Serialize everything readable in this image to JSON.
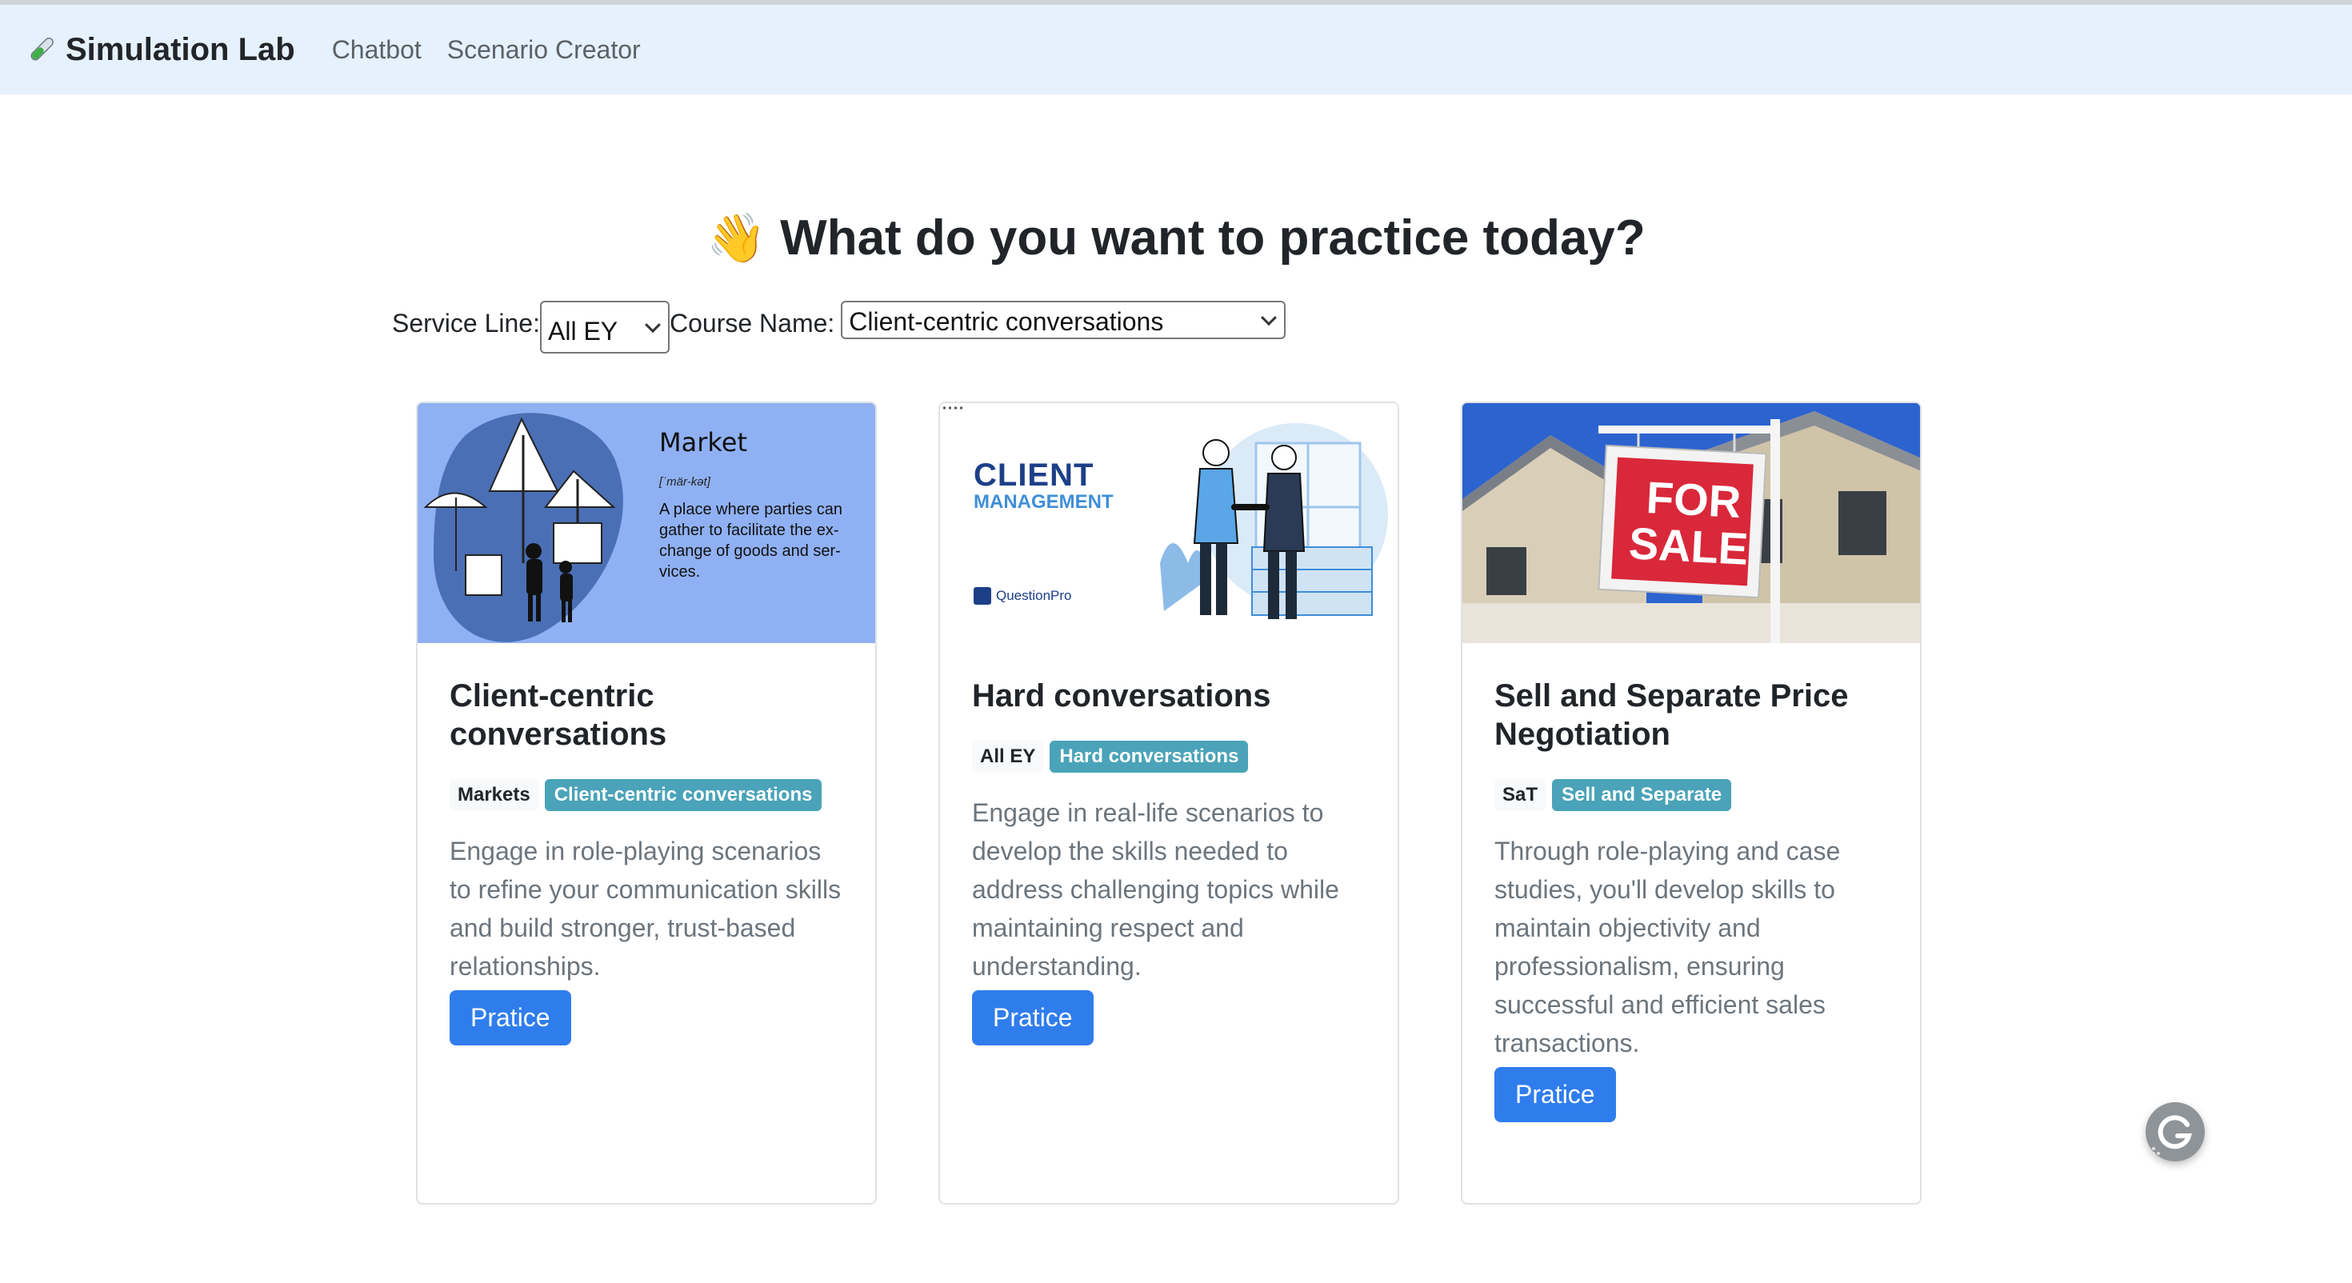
{
  "nav": {
    "brand": "Simulation Lab",
    "links": [
      "Chatbot",
      "Scenario Creator"
    ]
  },
  "page": {
    "emoji": "👋",
    "title": "What do you want to practice today?"
  },
  "filters": {
    "service_line_label": "Service Line:",
    "service_line_value": "All EY",
    "course_name_label": "Course Name:",
    "course_name_value": "Client-centric conversations"
  },
  "cards": [
    {
      "title": "Client-centric conversations",
      "badge_service": "Markets",
      "badge_course": "Client-centric conversations",
      "description": "Engage in role-playing scenarios to refine your communication skills and build stronger, trust-based relationships.",
      "button": "Pratice",
      "image": {
        "heading": "Market",
        "pronunciation": "[ˈmär-kət]",
        "definition": "A place where parties can gather to facilitate the ex-change of goods and ser-vices."
      }
    },
    {
      "title": "Hard conversations",
      "badge_service": "All EY",
      "badge_course": "Hard conversations",
      "description": "Engage in real-life scenarios to develop the skills needed to address challenging topics while maintaining respect and understanding.",
      "button": "Pratice",
      "image": {
        "line1": "CLIENT",
        "line2": "MANAGEMENT",
        "logo": "QuestionPro"
      }
    },
    {
      "title": "Sell and Separate Price Negotiation",
      "badge_service": "SaT",
      "badge_course": "Sell and Separate",
      "description": "Through role-playing and case studies, you'll develop skills to maintain objectivity and professionalism, ensuring successful and efficient sales transactions.",
      "button": "Pratice",
      "image": {
        "sign_line1": "FOR",
        "sign_line2": "SALE"
      }
    }
  ],
  "colors": {
    "navbar_bg": "#e5f1fc",
    "primary_button": "#2f7ded",
    "badge_info": "#4aa3b8"
  },
  "icons": {
    "brand": "test-tube-icon",
    "floating": "grammarly-icon"
  }
}
